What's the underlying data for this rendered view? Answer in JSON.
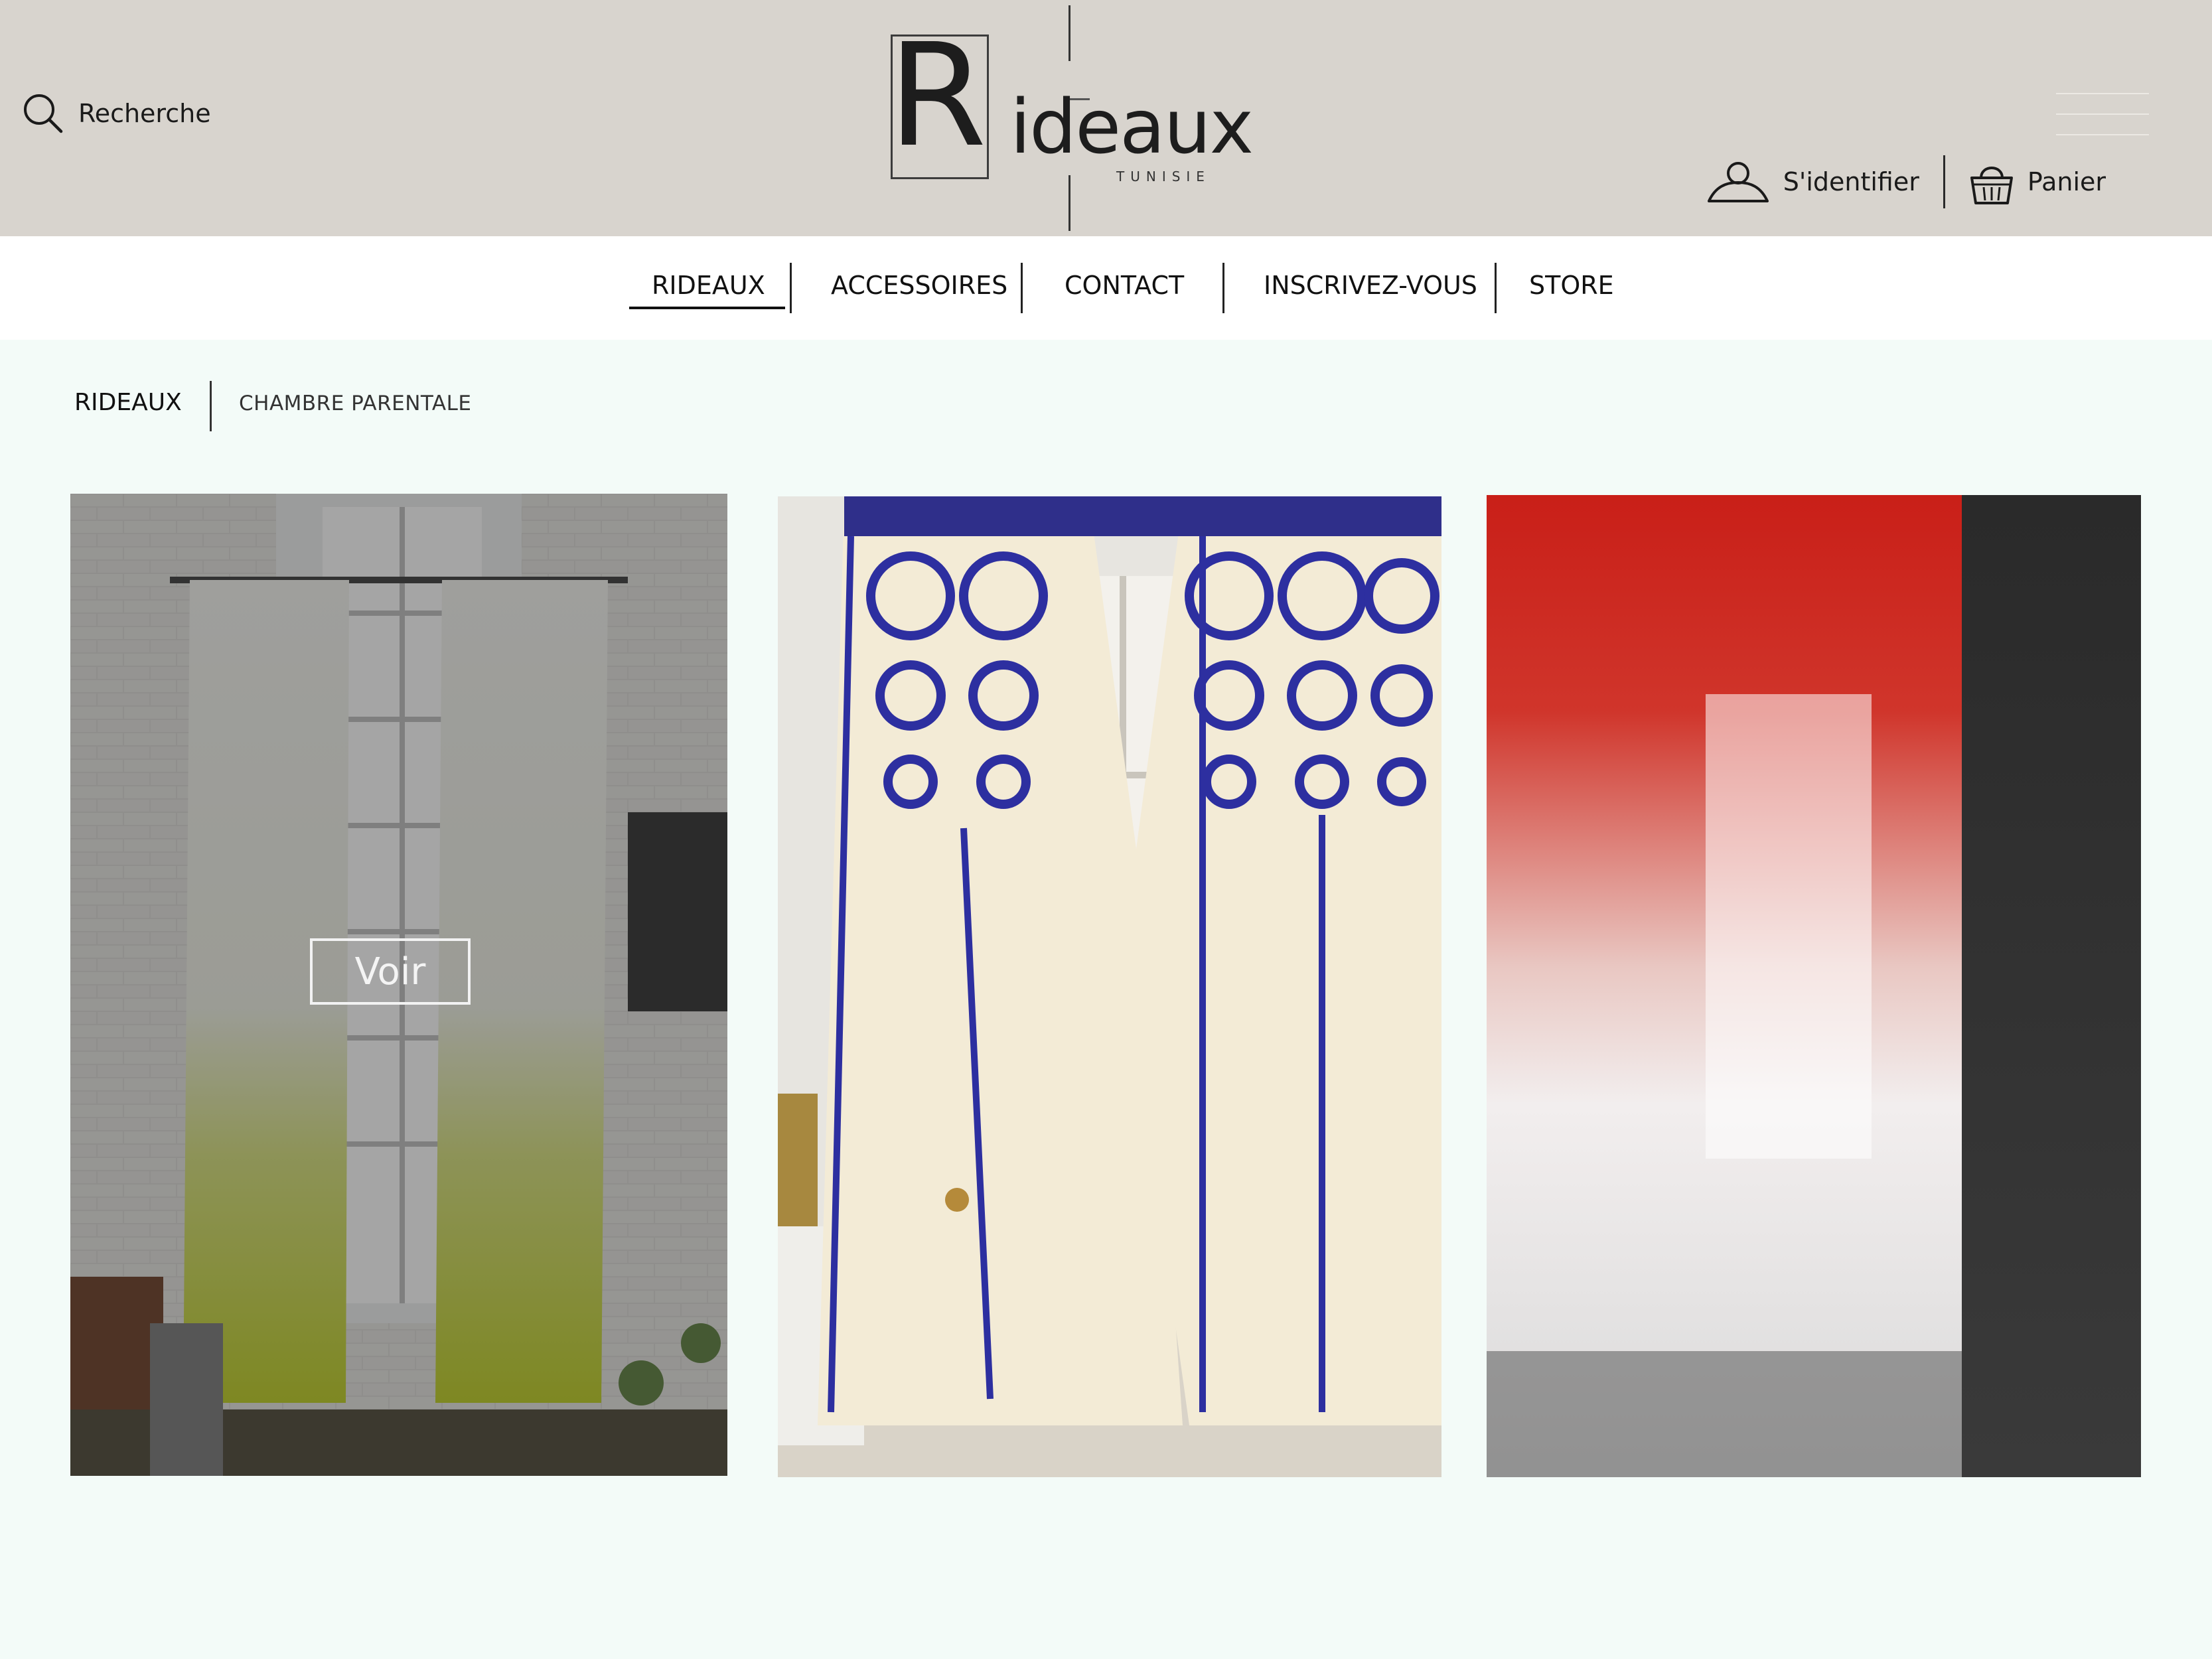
{
  "header": {
    "search_label": "Recherche",
    "search_icon": "search-icon",
    "logo": {
      "initial": "R",
      "word": "ideaux",
      "tagline": "TUNISIE"
    },
    "login_label": "S'identifier",
    "login_icon": "user-icon",
    "cart_label": "Panier",
    "cart_icon": "basket-icon",
    "menu_icon": "hamburger-icon"
  },
  "nav": {
    "items": [
      {
        "label": "RIDEAUX",
        "active": true
      },
      {
        "label": "ACCESSOIRES",
        "active": false
      },
      {
        "label": "CONTACT",
        "active": false
      },
      {
        "label": "INSCRIVEZ-VOUS",
        "active": false
      },
      {
        "label": "STORE",
        "active": false
      }
    ]
  },
  "breadcrumb": {
    "root": "RIDEAUX",
    "current": "CHAMBRE PARENTALE"
  },
  "products": [
    {
      "image": "white-to-lime-ombre-curtains",
      "hover_button": "Voir"
    },
    {
      "image": "cream-curtains-blue-medallion-embroidery"
    },
    {
      "image": "red-to-white-ombre-sheer-curtains"
    }
  ],
  "colors": {
    "header_bg": "#d8d4ce",
    "nav_bg": "#ffffff",
    "page_bg": "#f3fbf8",
    "text": "#111111"
  }
}
